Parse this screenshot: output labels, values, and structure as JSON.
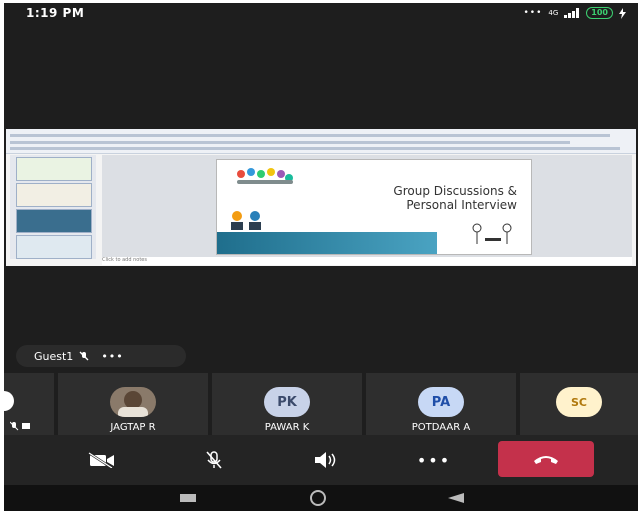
{
  "status_bar": {
    "time": "1:19 PM",
    "network": "4G",
    "battery": "100"
  },
  "shared_content": {
    "slide_title": "Group Discussions &\nPersonal Interview",
    "notes_placeholder": "Click to add notes"
  },
  "guest": {
    "name": "Guest1",
    "more": "•••"
  },
  "participants": [
    {
      "name": "JAGTAP R",
      "initials": ""
    },
    {
      "name": "PAWAR K",
      "initials": "PK"
    },
    {
      "name": "POTDAAR A",
      "initials": "PA"
    },
    {
      "name": "",
      "initials": "SC"
    }
  ],
  "controls": {
    "more_label": "•••"
  },
  "colors": {
    "background": "#1e1e1e",
    "hangup": "#c4314b",
    "battery": "#3cd070",
    "avatar_pk": "#c8d2e8",
    "avatar_pa": "#c7d8f5",
    "avatar_sc": "#fff2cc"
  }
}
